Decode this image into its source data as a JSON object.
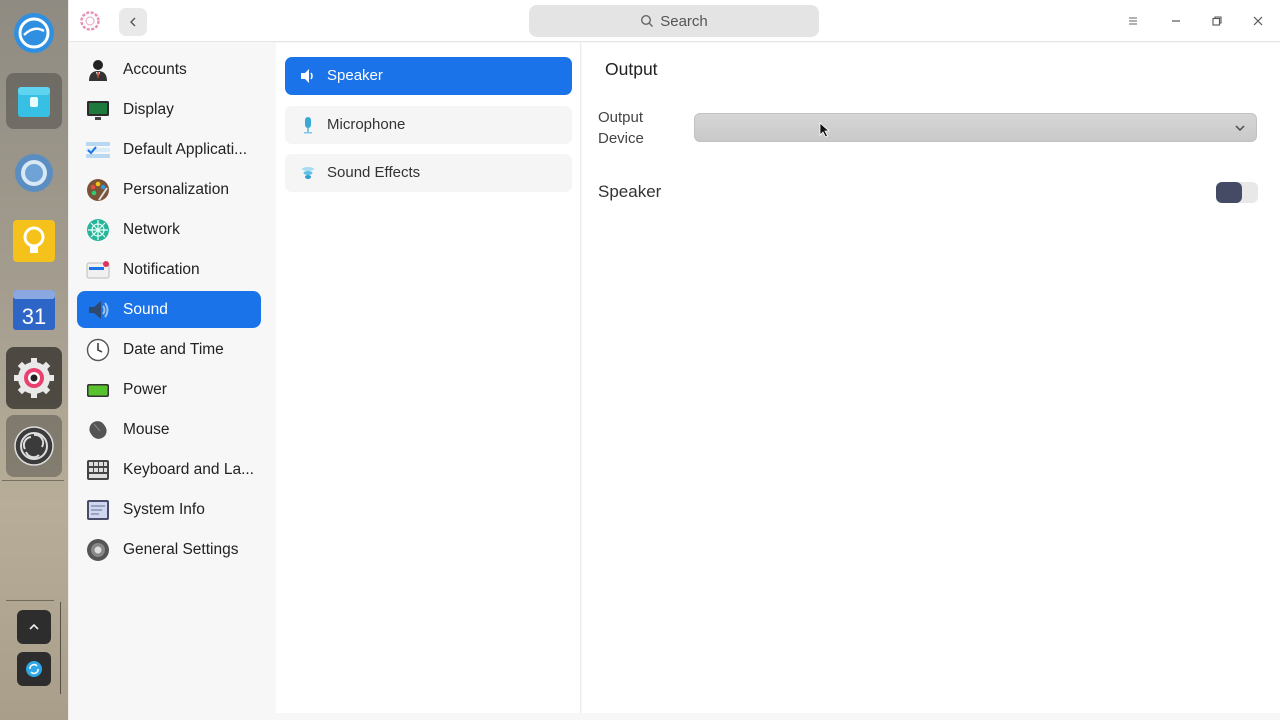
{
  "dock": {
    "apps": [
      {
        "name": "deepin-launcher-icon",
        "state": "normal"
      },
      {
        "name": "file-manager-icon",
        "state": "running"
      },
      {
        "name": "chromium-browser-icon",
        "state": "normal"
      },
      {
        "name": "lightbulb-notes-icon",
        "state": "normal"
      },
      {
        "name": "calendar-icon",
        "state": "normal",
        "label": "31"
      },
      {
        "name": "control-center-gear-icon",
        "state": "active"
      },
      {
        "name": "obs-studio-icon",
        "state": "running"
      }
    ],
    "tray": [
      "chevron-up-icon",
      "sync-icon"
    ]
  },
  "titlebar": {
    "search_placeholder": "Search",
    "icons": [
      "menu-icon",
      "minimize-icon",
      "restore-icon",
      "close-icon"
    ]
  },
  "sidebar": {
    "items": [
      {
        "label": "Accounts",
        "icon": "accounts-icon"
      },
      {
        "label": "Display",
        "icon": "display-icon"
      },
      {
        "label": "Default Applicati...",
        "icon": "default-applications-icon"
      },
      {
        "label": "Personalization",
        "icon": "personalization-icon"
      },
      {
        "label": "Network",
        "icon": "network-icon"
      },
      {
        "label": "Notification",
        "icon": "notification-icon"
      },
      {
        "label": "Sound",
        "icon": "sound-icon",
        "selected": true
      },
      {
        "label": "Date and Time",
        "icon": "clock-icon"
      },
      {
        "label": "Power",
        "icon": "battery-icon"
      },
      {
        "label": "Mouse",
        "icon": "mouse-icon"
      },
      {
        "label": "Keyboard and La...",
        "icon": "keyboard-icon"
      },
      {
        "label": "System Info",
        "icon": "system-info-icon"
      },
      {
        "label": "General Settings",
        "icon": "general-settings-icon"
      }
    ]
  },
  "sound_menu": {
    "items": [
      {
        "label": "Speaker",
        "icon": "speaker-icon",
        "selected": true
      },
      {
        "label": "Microphone",
        "icon": "microphone-icon"
      },
      {
        "label": "Sound Effects",
        "icon": "sound-effects-icon"
      }
    ]
  },
  "output": {
    "title": "Output",
    "device_label": "Output Device",
    "device_value": "",
    "speaker_label": "Speaker",
    "speaker_enabled": false
  },
  "colors": {
    "accent": "#1a73e8",
    "toggle_knob": "#454b64"
  }
}
